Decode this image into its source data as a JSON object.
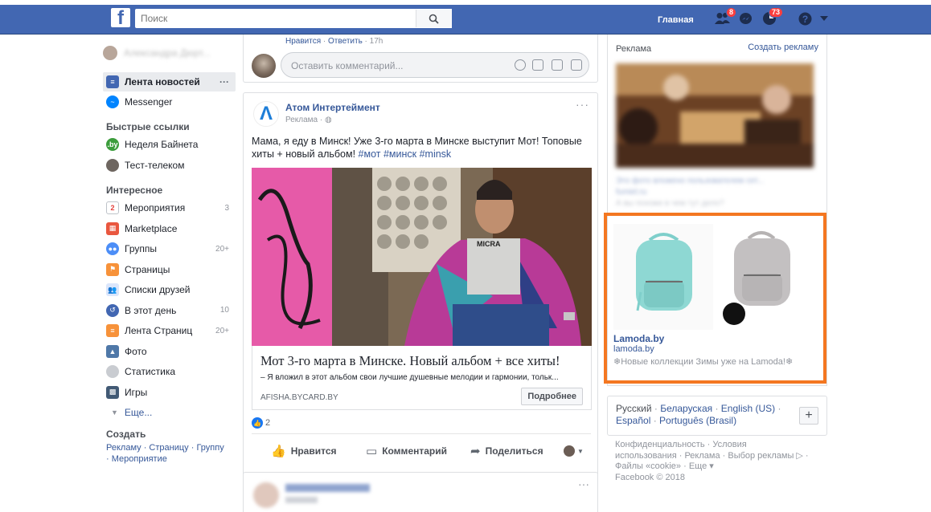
{
  "colors": {
    "brand": "#4267b2",
    "link": "#365899",
    "highlight": "#f47721"
  },
  "topbar": {
    "search_placeholder": "Поиск",
    "home_label": "Главная",
    "friend_requests_count": "8",
    "notifications_count": "73",
    "icons": [
      "friends-icon",
      "messenger-icon",
      "notifications-icon",
      "help-icon",
      "caret-down-icon"
    ]
  },
  "sidebar": {
    "items_main": [
      {
        "label": "Лента новостей",
        "icon": "news-feed-icon",
        "more": "···"
      },
      {
        "label": "Messenger",
        "icon": "messenger-icon"
      }
    ],
    "quick_links_heading": "Быстрые ссылки",
    "quick_links": [
      {
        "label": "Неделя Байнета",
        "icon": "by-icon"
      },
      {
        "label": "Тест-телеком",
        "icon": "group-avatar-icon"
      }
    ],
    "explore_heading": "Интересное",
    "explore": [
      {
        "label": "Мероприятия",
        "count": "3",
        "icon": "calendar-icon"
      },
      {
        "label": "Marketplace",
        "count": "",
        "icon": "shop-icon"
      },
      {
        "label": "Группы",
        "count": "20+",
        "icon": "groups-icon"
      },
      {
        "label": "Страницы",
        "count": "",
        "icon": "flag-icon"
      },
      {
        "label": "Списки друзей",
        "count": "",
        "icon": "friend-lists-icon"
      },
      {
        "label": "В этот день",
        "count": "10",
        "icon": "memories-icon"
      },
      {
        "label": "Лента Страниц",
        "count": "20+",
        "icon": "pages-feed-icon"
      },
      {
        "label": "Фото",
        "count": "",
        "icon": "photo-icon"
      },
      {
        "label": "Статистика",
        "count": "",
        "icon": "stats-icon"
      },
      {
        "label": "Игры",
        "count": "",
        "icon": "games-icon"
      }
    ],
    "more_label": "Еще...",
    "create_heading": "Создать",
    "create_links": [
      "Рекламу",
      "Страницу",
      "Группу",
      "Мероприятие"
    ]
  },
  "feed": {
    "comment_meta": {
      "like": "Нравится",
      "reply": "Ответить",
      "time": "17h"
    },
    "comment_placeholder": "Оставить комментарий...",
    "ad_post": {
      "author": "Атом Интертеймент",
      "sponsored": "Реклама",
      "text": "Мама, я еду в Минск! Уже 3-го марта в Минске выступит Мот! Топовые хиты + новый альбом!",
      "tags": "#мот #минск #minsk",
      "link_title": "Мот 3-го марта в Минске. Новый альбом + все хиты!",
      "link_desc": "– Я вложил в этот альбом свои лучшие душевные мелодии и гармонии, тольк...",
      "link_domain": "AFISHA.BYCARD.BY",
      "link_button": "Подробнее",
      "likes_count": "2",
      "actions": {
        "like": "Нравится",
        "comment": "Комментарий",
        "share": "Поделиться"
      }
    }
  },
  "right": {
    "ads_heading": "Реклама",
    "create_ad": "Создать рекламу",
    "ad2": {
      "title": "Lamoda.by",
      "domain": "lamoda.by",
      "text": "❄Новые коллекции Зимы уже на Lamoda!❄"
    },
    "languages": [
      {
        "label": "Русский",
        "current": true
      },
      {
        "label": "Беларуская"
      },
      {
        "label": "English (US)"
      },
      {
        "label": "Español"
      },
      {
        "label": "Português (Brasil)"
      }
    ],
    "add_language": "+",
    "footer_lines": [
      "Конфиденциальность · Условия",
      "использования · Реклама · Выбор рекламы ▷ ·",
      "Файлы «cookie» · Еще ▾",
      "Facebook © 2018"
    ]
  }
}
